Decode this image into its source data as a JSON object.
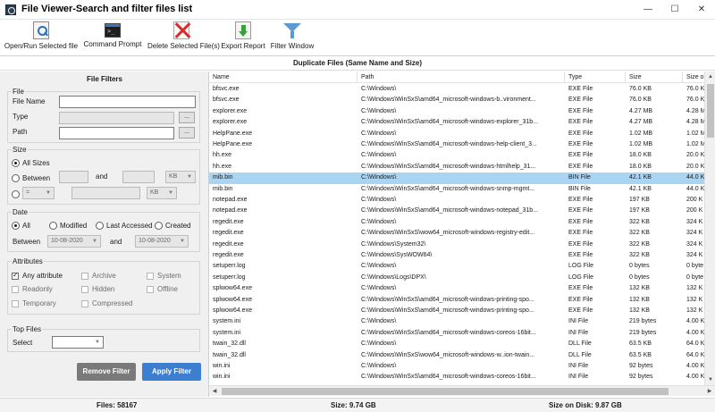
{
  "window": {
    "title": "File Viewer-Search and filter files list",
    "min": "—",
    "max": "☐",
    "close": "✕"
  },
  "toolbar": {
    "open": "Open/Run Selected file",
    "cmd": "Command Prompt",
    "delete": "Delete Selected File(s)",
    "export": "Export Report",
    "filter": "Filter Window"
  },
  "duplicate_header": "Duplicate Files (Same Name and Size)",
  "filters": {
    "title": "File Filters",
    "file_group": {
      "title": "File",
      "name_label": "File Name",
      "type_label": "Type",
      "path_label": "Path",
      "dots": "..."
    },
    "size_group": {
      "title": "Size",
      "all_sizes": "All Sizes",
      "between": "Between",
      "and": "and",
      "unit1": "KB",
      "op": "=",
      "unit2": "KB"
    },
    "date_group": {
      "title": "Date",
      "all": "All",
      "modified": "Modified",
      "last_accessed": "Last Accessed",
      "created": "Created",
      "between": "Between",
      "from": "10-08-2020",
      "and": "and",
      "to": "10-08-2020"
    },
    "attr_group": {
      "title": "Attributes",
      "any": "Any attribute",
      "archive": "Archive",
      "system": "System",
      "readonly": "Readonly",
      "hidden": "Hidden",
      "offline": "Offline",
      "temporary": "Temporary",
      "compressed": "Compressed"
    },
    "top_group": {
      "title": "Top Files",
      "select_label": "Select"
    },
    "remove_button": "Remove Filter",
    "apply_button": "Apply Filter"
  },
  "table": {
    "columns": [
      "Name",
      "Path",
      "Type",
      "Size",
      "Size o"
    ],
    "rows": [
      [
        "bfsvc.exe",
        "C:\\Windows\\",
        "EXE File",
        "76.0 KB",
        "76.0 K"
      ],
      [
        "bfsvc.exe",
        "C:\\Windows\\WinSxS\\amd64_microsoft-windows-b..vironment...",
        "EXE File",
        "76.0 KB",
        "76.0 K"
      ],
      [
        "explorer.exe",
        "C:\\Windows\\",
        "EXE File",
        "4.27 MB",
        "4.28 M"
      ],
      [
        "explorer.exe",
        "C:\\Windows\\WinSxS\\amd64_microsoft-windows-explorer_31b...",
        "EXE File",
        "4.27 MB",
        "4.28 M"
      ],
      [
        "HelpPane.exe",
        "C:\\Windows\\",
        "EXE File",
        "1.02 MB",
        "1.02 M"
      ],
      [
        "HelpPane.exe",
        "C:\\Windows\\WinSxS\\amd64_microsoft-windows-help-client_3...",
        "EXE File",
        "1.02 MB",
        "1.02 M"
      ],
      [
        "hh.exe",
        "C:\\Windows\\",
        "EXE File",
        "18.0 KB",
        "20.0 K"
      ],
      [
        "hh.exe",
        "C:\\Windows\\WinSxS\\amd64_microsoft-windows-htmlhelp_31...",
        "EXE File",
        "18.0 KB",
        "20.0 K"
      ],
      [
        "mib.bin",
        "C:\\Windows\\",
        "BIN File",
        "42.1 KB",
        "44.0 K"
      ],
      [
        "mib.bin",
        "C:\\Windows\\WinSxS\\amd64_microsoft-windows-snmp-mgmt...",
        "BIN File",
        "42.1 KB",
        "44.0 K"
      ],
      [
        "notepad.exe",
        "C:\\Windows\\",
        "EXE File",
        "197 KB",
        "200 K"
      ],
      [
        "notepad.exe",
        "C:\\Windows\\WinSxS\\amd64_microsoft-windows-notepad_31b...",
        "EXE File",
        "197 KB",
        "200 K"
      ],
      [
        "regedit.exe",
        "C:\\Windows\\",
        "EXE File",
        "322 KB",
        "324 K"
      ],
      [
        "regedit.exe",
        "C:\\Windows\\WinSxS\\wow64_microsoft-windows-registry-edit...",
        "EXE File",
        "322 KB",
        "324 K"
      ],
      [
        "regedit.exe",
        "C:\\Windows\\System32\\",
        "EXE File",
        "322 KB",
        "324 K"
      ],
      [
        "regedit.exe",
        "C:\\Windows\\SysWOW64\\",
        "EXE File",
        "322 KB",
        "324 K"
      ],
      [
        "setuperr.log",
        "C:\\Windows\\",
        "LOG File",
        "0 bytes",
        "0 byte"
      ],
      [
        "setuperr.log",
        "C:\\Windows\\Logs\\DPX\\",
        "LOG File",
        "0 bytes",
        "0 byte"
      ],
      [
        "splwow64.exe",
        "C:\\Windows\\",
        "EXE File",
        "132 KB",
        "132 K"
      ],
      [
        "splwow64.exe",
        "C:\\Windows\\WinSxS\\amd64_microsoft-windows-printing-spo...",
        "EXE File",
        "132 KB",
        "132 K"
      ],
      [
        "splwow64.exe",
        "C:\\Windows\\WinSxS\\amd64_microsoft-windows-printing-spo...",
        "EXE File",
        "132 KB",
        "132 K"
      ],
      [
        "system.ini",
        "C:\\Windows\\",
        "INI File",
        "219 bytes",
        "4.00 K"
      ],
      [
        "system.ini",
        "C:\\Windows\\WinSxS\\amd64_microsoft-windows-coreos-16bit...",
        "INI File",
        "219 bytes",
        "4.00 K"
      ],
      [
        "twain_32.dll",
        "C:\\Windows\\",
        "DLL File",
        "63.5 KB",
        "64.0 K"
      ],
      [
        "twain_32.dll",
        "C:\\Windows\\WinSxS\\wow64_microsoft-windows-w..ion-twain...",
        "DLL File",
        "63.5 KB",
        "64.0 K"
      ],
      [
        "win.ini",
        "C:\\Windows\\",
        "INI File",
        "92 bytes",
        "4.00 K"
      ],
      [
        "win.ini",
        "C:\\Windows\\WinSxS\\amd64_microsoft-windows-coreos-16bit...",
        "INI File",
        "92 bytes",
        "4.00 K"
      ]
    ],
    "selected_row": 8
  },
  "status": {
    "files": "Files: 58167",
    "size": "Size: 9.74 GB",
    "disk": "Size on Disk: 9.87 GB"
  },
  "colors": {
    "selected_row": "#a9d4f2",
    "apply": "#3c7fd0",
    "remove": "#7a7a7a"
  }
}
